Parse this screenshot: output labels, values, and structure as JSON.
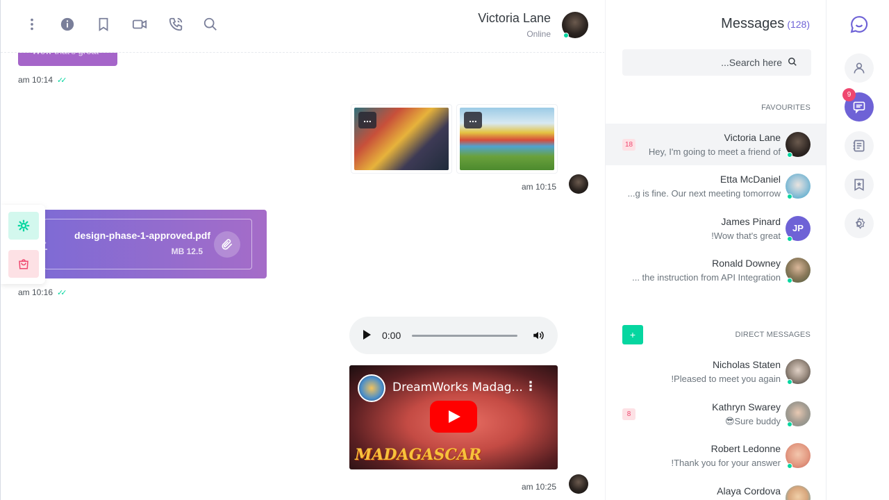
{
  "header": {
    "contact_name": "Victoria Lane",
    "contact_status": "Online",
    "icons": [
      "more-vert-icon",
      "info-icon",
      "bookmark-icon",
      "video-call-icon",
      "phone-call-icon",
      "search-icon"
    ]
  },
  "chat": {
    "top_bubble_text": "Wow that's great",
    "time_1": "am 10:14",
    "time_2": "am 10:15",
    "file": {
      "name": "design-phase-1-approved.pdf",
      "size": "MB 12.5"
    },
    "time_3": "am 10:16",
    "audio": {
      "current_time": "0:00"
    },
    "video": {
      "title": "DreamWorks Madag...",
      "logo_text": "MADAGASCAR"
    },
    "time_4": "am 10:25",
    "image_more_label": "..."
  },
  "messages": {
    "title": "Messages",
    "count": "(128)",
    "search_placeholder": "...Search here",
    "favourites_label": "FAVOURITES",
    "direct_label": "DIRECT MESSAGES",
    "add_label": "+",
    "favourites": [
      {
        "name": "Victoria Lane",
        "message": "Hey, I'm going to meet a friend of",
        "badge": "18",
        "active": true,
        "color": "#2e2622"
      },
      {
        "name": "Etta McDaniel",
        "message": "...g is fine. Our next meeting tomorrow",
        "badge": "",
        "color": "#3ba1c9"
      },
      {
        "name": "James Pinard",
        "message": "!Wow that's great",
        "badge": "",
        "initials": "JP",
        "color": "#6e62d6"
      },
      {
        "name": "Ronald Downey",
        "message": "... the instruction from API Integration",
        "badge": "",
        "color": "#5f6b4e"
      }
    ],
    "direct": [
      {
        "name": "Nicholas Staten",
        "message": "!Pleased to meet you again",
        "badge": "",
        "color": "#7a7068"
      },
      {
        "name": "Kathryn Swarey",
        "message": "😎Sure buddy",
        "badge": "8",
        "color": "#9aa5a0"
      },
      {
        "name": "Robert Ledonne",
        "message": "!Thank you for your answer",
        "badge": "",
        "color": "#e39a82"
      },
      {
        "name": "Alaya Cordova",
        "message": "",
        "badge": "",
        "color": "#d8a67c"
      }
    ]
  },
  "rail": {
    "notification_count": "9",
    "icons": [
      "logo-chat-icon",
      "user-icon",
      "chats-icon",
      "contacts-icon",
      "bookmark-icon",
      "settings-icon"
    ]
  },
  "colors": {
    "primary": "#6e62d6",
    "success": "#06d6a0",
    "danger": "#ef476f"
  }
}
